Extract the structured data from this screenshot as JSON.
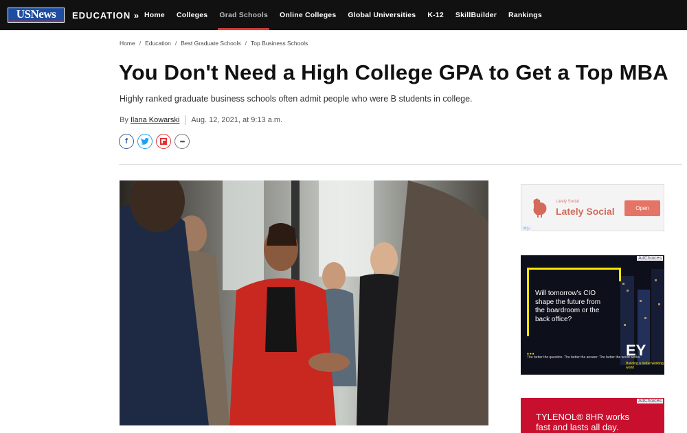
{
  "nav": {
    "logo": "USNews",
    "section": "EDUCATION »",
    "links": [
      "Home",
      "Colleges",
      "Grad Schools",
      "Online Colleges",
      "Global Universities",
      "K-12",
      "SkillBuilder",
      "Rankings"
    ]
  },
  "breadcrumb": [
    "Home",
    "Education",
    "Best Graduate Schools",
    "Top Business Schools"
  ],
  "article": {
    "title": "You Don't Need a High College GPA to Get a Top MBA",
    "subtitle": "Highly ranked graduate business schools often admit people who were B students in college.",
    "by": "By",
    "author": "Ilana Kowarski",
    "date": "Aug. 12, 2021, at 9:13 a.m."
  },
  "share": {
    "facebook": "f",
    "twitter": "t",
    "flipboard": "f",
    "more": "•••"
  },
  "ads": {
    "ad1": {
      "small": "Lately Social",
      "brand": "Lately Social",
      "button": "Open"
    },
    "ad2": {
      "choices": "AdChoices",
      "headline": "Will tomorrow's CIO shape the future from the boardroom or the back office?",
      "tagline": "The better the question. The better the answer. The better the world works.",
      "brand": "EY",
      "brand_sub": "Building a better working world"
    },
    "ad3": {
      "choices": "AdChoices",
      "line1": "TYLENOL® 8HR works",
      "line2": "fast and lasts all day."
    }
  }
}
